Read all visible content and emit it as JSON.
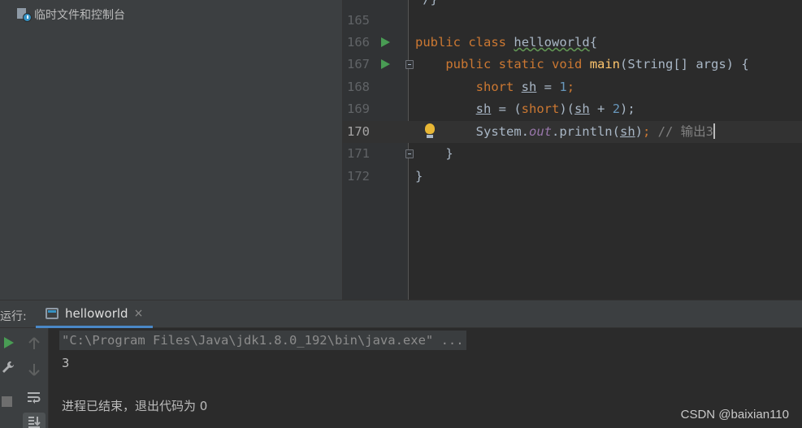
{
  "project_tree": {
    "scratches_label": "临时文件和控制台"
  },
  "editor": {
    "lines": [
      {
        "number": "165"
      },
      {
        "number": "166"
      },
      {
        "number": "167"
      },
      {
        "number": "168"
      },
      {
        "number": "169"
      },
      {
        "number": "170"
      },
      {
        "number": "171"
      },
      {
        "number": "172"
      }
    ],
    "partial_top_code": "*/}",
    "tokens": {
      "public": "public",
      "class": "class",
      "static": "static",
      "void": "void",
      "short": "short",
      "class_name": "helloworld",
      "method_name": "main",
      "main_params": "(String[] args) {",
      "var": "sh",
      "assign": " = ",
      "one": "1",
      "two": "2",
      "semicolon": ";",
      "lparen_short": "(",
      "rparen_cast": ")(",
      "plus": " + ",
      "close_stmt": ");",
      "system": "System.",
      "out": "out",
      "println": ".println(",
      "rparen": ")",
      "comment": " // 输出3",
      "open_brace": "{",
      "close_brace": "}"
    }
  },
  "run_window": {
    "label": "运行:",
    "tab_name": "helloworld",
    "tab_close": "×"
  },
  "console": {
    "command": "\"C:\\Program Files\\Java\\jdk1.8.0_192\\bin\\java.exe\" ...",
    "output": "3",
    "exit_message": "进程已结束，退出代码为 0"
  },
  "watermark": "CSDN @baixian110",
  "colors": {
    "keyword": "#cc7832",
    "function": "#ffc66d",
    "number": "#6897bb",
    "comment": "#808080",
    "field": "#9876aa",
    "run_green": "#499c54"
  }
}
